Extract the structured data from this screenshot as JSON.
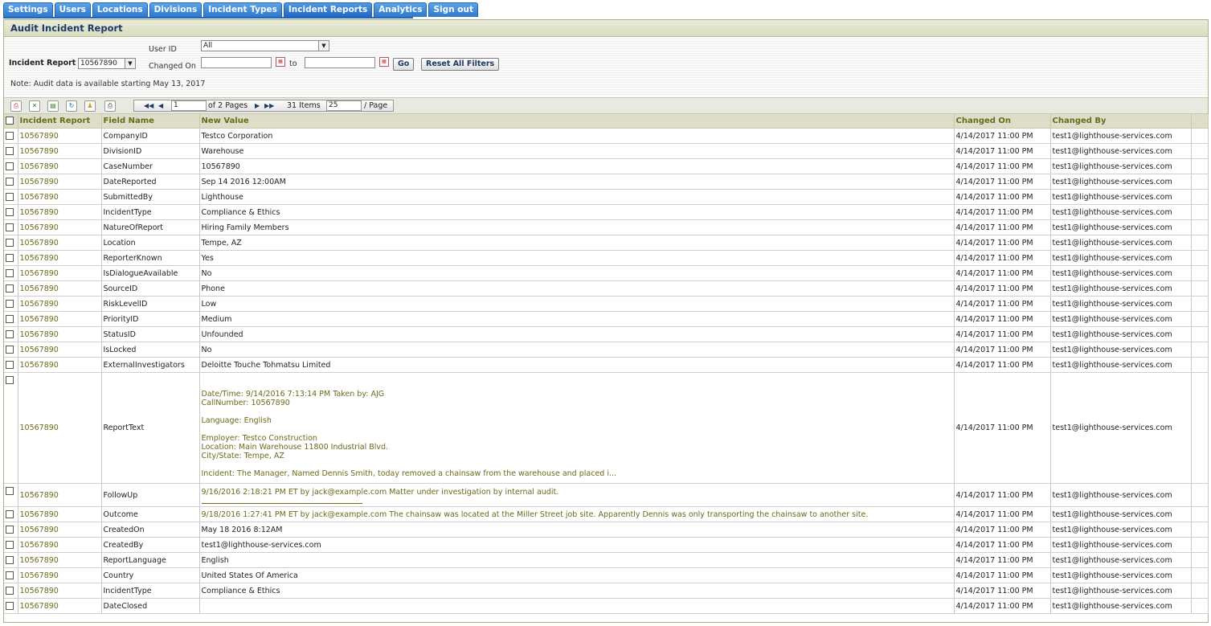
{
  "tabs": [
    "Settings",
    "Users",
    "Locations",
    "Divisions",
    "Incident Types",
    "Incident Reports",
    "Analytics",
    "Sign out"
  ],
  "active_tab": "Incident Reports",
  "panel_title": "Audit Incident Report",
  "filters": {
    "incident_report_label": "Incident Report",
    "incident_report_value": "10567890",
    "user_id_label": "User ID",
    "user_id_value": "All",
    "changed_on_label": "Changed On",
    "to_label": "to",
    "changed_on_from": "",
    "changed_on_to": "",
    "go_label": "Go",
    "reset_label": "Reset All Filters",
    "note": "Note: Audit data is available starting May 13, 2017"
  },
  "pager": {
    "page": "1",
    "of_pages": "of 2 Pages",
    "items": "31 Items",
    "page_size": "25",
    "per_page": "/ Page"
  },
  "columns": [
    "Incident Report",
    "Field Name",
    "New Value",
    "Changed On",
    "Changed By"
  ],
  "rows": [
    {
      "ir": "10567890",
      "field": "CompanyID",
      "value": "Testco Corporation",
      "on": "4/14/2017 11:00 PM",
      "by": "test1@lighthouse-services.com"
    },
    {
      "ir": "10567890",
      "field": "DivisionID",
      "value": "Warehouse",
      "on": "4/14/2017 11:00 PM",
      "by": "test1@lighthouse-services.com"
    },
    {
      "ir": "10567890",
      "field": "CaseNumber",
      "value": "10567890",
      "on": "4/14/2017 11:00 PM",
      "by": "test1@lighthouse-services.com"
    },
    {
      "ir": "10567890",
      "field": "DateReported",
      "value": "Sep 14 2016 12:00AM",
      "on": "4/14/2017 11:00 PM",
      "by": "test1@lighthouse-services.com"
    },
    {
      "ir": "10567890",
      "field": "SubmittedBy",
      "value": "Lighthouse",
      "on": "4/14/2017 11:00 PM",
      "by": "test1@lighthouse-services.com"
    },
    {
      "ir": "10567890",
      "field": "IncidentType",
      "value": "Compliance & Ethics",
      "on": "4/14/2017 11:00 PM",
      "by": "test1@lighthouse-services.com"
    },
    {
      "ir": "10567890",
      "field": "NatureOfReport",
      "value": "Hiring Family Members",
      "on": "4/14/2017 11:00 PM",
      "by": "test1@lighthouse-services.com"
    },
    {
      "ir": "10567890",
      "field": "Location",
      "value": "Tempe, AZ",
      "on": "4/14/2017 11:00 PM",
      "by": "test1@lighthouse-services.com"
    },
    {
      "ir": "10567890",
      "field": "ReporterKnown",
      "value": "Yes",
      "on": "4/14/2017 11:00 PM",
      "by": "test1@lighthouse-services.com"
    },
    {
      "ir": "10567890",
      "field": "IsDialogueAvailable",
      "value": "No",
      "on": "4/14/2017 11:00 PM",
      "by": "test1@lighthouse-services.com"
    },
    {
      "ir": "10567890",
      "field": "SourceID",
      "value": "Phone",
      "on": "4/14/2017 11:00 PM",
      "by": "test1@lighthouse-services.com"
    },
    {
      "ir": "10567890",
      "field": "RiskLevelID",
      "value": "Low",
      "on": "4/14/2017 11:00 PM",
      "by": "test1@lighthouse-services.com"
    },
    {
      "ir": "10567890",
      "field": "PriorityID",
      "value": "Medium",
      "on": "4/14/2017 11:00 PM",
      "by": "test1@lighthouse-services.com"
    },
    {
      "ir": "10567890",
      "field": "StatusID",
      "value": "Unfounded",
      "on": "4/14/2017 11:00 PM",
      "by": "test1@lighthouse-services.com"
    },
    {
      "ir": "10567890",
      "field": "IsLocked",
      "value": "No",
      "on": "4/14/2017 11:00 PM",
      "by": "test1@lighthouse-services.com"
    },
    {
      "ir": "10567890",
      "field": "ExternalInvestigators",
      "value": "Deloitte Touche Tohmatsu Limited",
      "on": "4/14/2017 11:00 PM",
      "by": "test1@lighthouse-services.com"
    }
  ],
  "report_text_row": {
    "ir": "10567890",
    "field": "ReportText",
    "on": "4/14/2017 11:00 PM",
    "by": "test1@lighthouse-services.com",
    "lines": [
      "Date/Time: 9/14/2016 7:13:14 PM Taken by: AJG",
      "CallNumber: 10567890",
      "",
      "Language: English",
      "",
      "Employer: Testco Construction",
      "Location: Main Warehouse 11800 Industrial Blvd.",
      "City/State: Tempe, AZ",
      "",
      "Incident: The Manager, Named Dennis Smith, today removed a chainsaw from the warehouse and placed i..."
    ]
  },
  "followup_row": {
    "ir": "10567890",
    "field": "FollowUp",
    "value": "9/16/2016 2:18:21 PM ET by jack@example.com Matter under investigation by internal audit.",
    "on": "4/14/2017 11:00 PM",
    "by": "test1@lighthouse-services.com"
  },
  "outcome_row": {
    "ir": "10567890",
    "field": "Outcome",
    "value": "9/18/2016 1:27:41 PM ET by jack@example.com The chainsaw was located at the Miller Street job site.  Apparently Dennis was only transporting the chainsaw to another site.",
    "on": "4/14/2017 11:00 PM",
    "by": "test1@lighthouse-services.com"
  },
  "tail_rows": [
    {
      "ir": "10567890",
      "field": "CreatedOn",
      "value": "May 18 2016 8:12AM",
      "on": "4/14/2017 11:00 PM",
      "by": "test1@lighthouse-services.com"
    },
    {
      "ir": "10567890",
      "field": "CreatedBy",
      "value": "test1@lighthouse-services.com",
      "on": "4/14/2017 11:00 PM",
      "by": "test1@lighthouse-services.com"
    },
    {
      "ir": "10567890",
      "field": "ReportLanguage",
      "value": "English",
      "on": "4/14/2017 11:00 PM",
      "by": "test1@lighthouse-services.com"
    },
    {
      "ir": "10567890",
      "field": "Country",
      "value": "United States Of America",
      "on": "4/14/2017 11:00 PM",
      "by": "test1@lighthouse-services.com"
    },
    {
      "ir": "10567890",
      "field": "IncidentType",
      "value": "Compliance & Ethics",
      "on": "4/14/2017 11:00 PM",
      "by": "test1@lighthouse-services.com"
    },
    {
      "ir": "10567890",
      "field": "DateClosed",
      "value": "",
      "on": "4/14/2017 11:00 PM",
      "by": "test1@lighthouse-services.com"
    }
  ],
  "toolbar_icons": [
    "pdf-export-icon",
    "excel-export-icon",
    "csv-export-icon",
    "refresh-icon",
    "clear-filter-icon",
    "print-icon"
  ],
  "colors": {
    "tab": "#2f79cc",
    "link": "#6b6a1a",
    "header_bg": "#dcdec9",
    "title": "#1d3a66"
  }
}
